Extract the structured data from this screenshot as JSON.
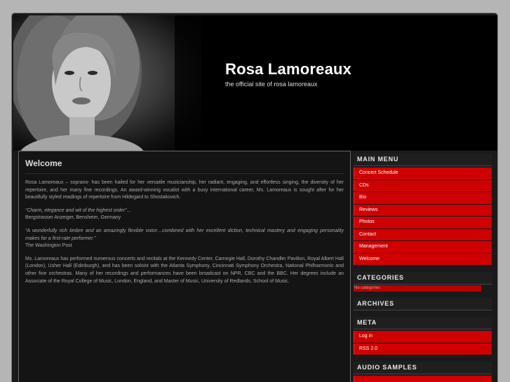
{
  "header": {
    "title": "Rosa Lamoreaux",
    "tagline": "the official site of rosa lamoreaux"
  },
  "main": {
    "heading": "Welcome",
    "intro": "Rosa Lamoreaux – soprano- has been hailed for her versatile musicianship, her radiant, engaging, and effortless singing, the diversity of her repertoire, and her many fine recordings. An award-winning vocalist with a busy international career, Ms. Lamoreaux is sought after for her beautifully styled readings of repertoire from Hildegard to Shostakovich.",
    "quote1": "“Charm, elegance and wit of the highest order”…",
    "source1": "Bergstrasser Anzeiger, Bensheim, Germany",
    "quote2": "“A wonderfully rich timbre and an amazingly flexible voice…combined with her excellent diction, technical mastery and engaging personality makes for a first-rate performer.”",
    "source2": "The Washington Post",
    "bio": "Ms. Lamoreaux has performed numerous concerts and recitals at the Kennedy Center, Carnegie Hall, Dorothy Chandler Pavilion, Royal Albert Hall (London), Usher Hall (Edinburgh), and has been soloist with the Atlanta Symphony, Cincinnati Symphony Orchestra, National Philharmonic and other fine orchestras. Many of her recordings and performances have been broadcast on NPR, CBC and the BBC. Her degrees include an Associate of the Royal College of Music, London, England, and Master of Music, University of Redlands, School of Music."
  },
  "sidebar": {
    "main_menu": {
      "heading": "MAIN MENU",
      "items": [
        "Concert Schedule",
        "CDs",
        "Bio",
        "Reviews",
        "Photos",
        "Contact",
        "Management",
        "Welcome"
      ]
    },
    "categories": {
      "heading": "CATEGORIES",
      "empty": "No categories"
    },
    "archives": {
      "heading": "ARCHIVES"
    },
    "meta": {
      "heading": "META",
      "items": [
        "Log in",
        "RSS 2.0"
      ]
    },
    "audio": {
      "heading": "AUDIO SAMPLES"
    }
  },
  "colors": {
    "accent": "#cf0000",
    "background": "#b5b5b5",
    "panel": "#141414"
  }
}
